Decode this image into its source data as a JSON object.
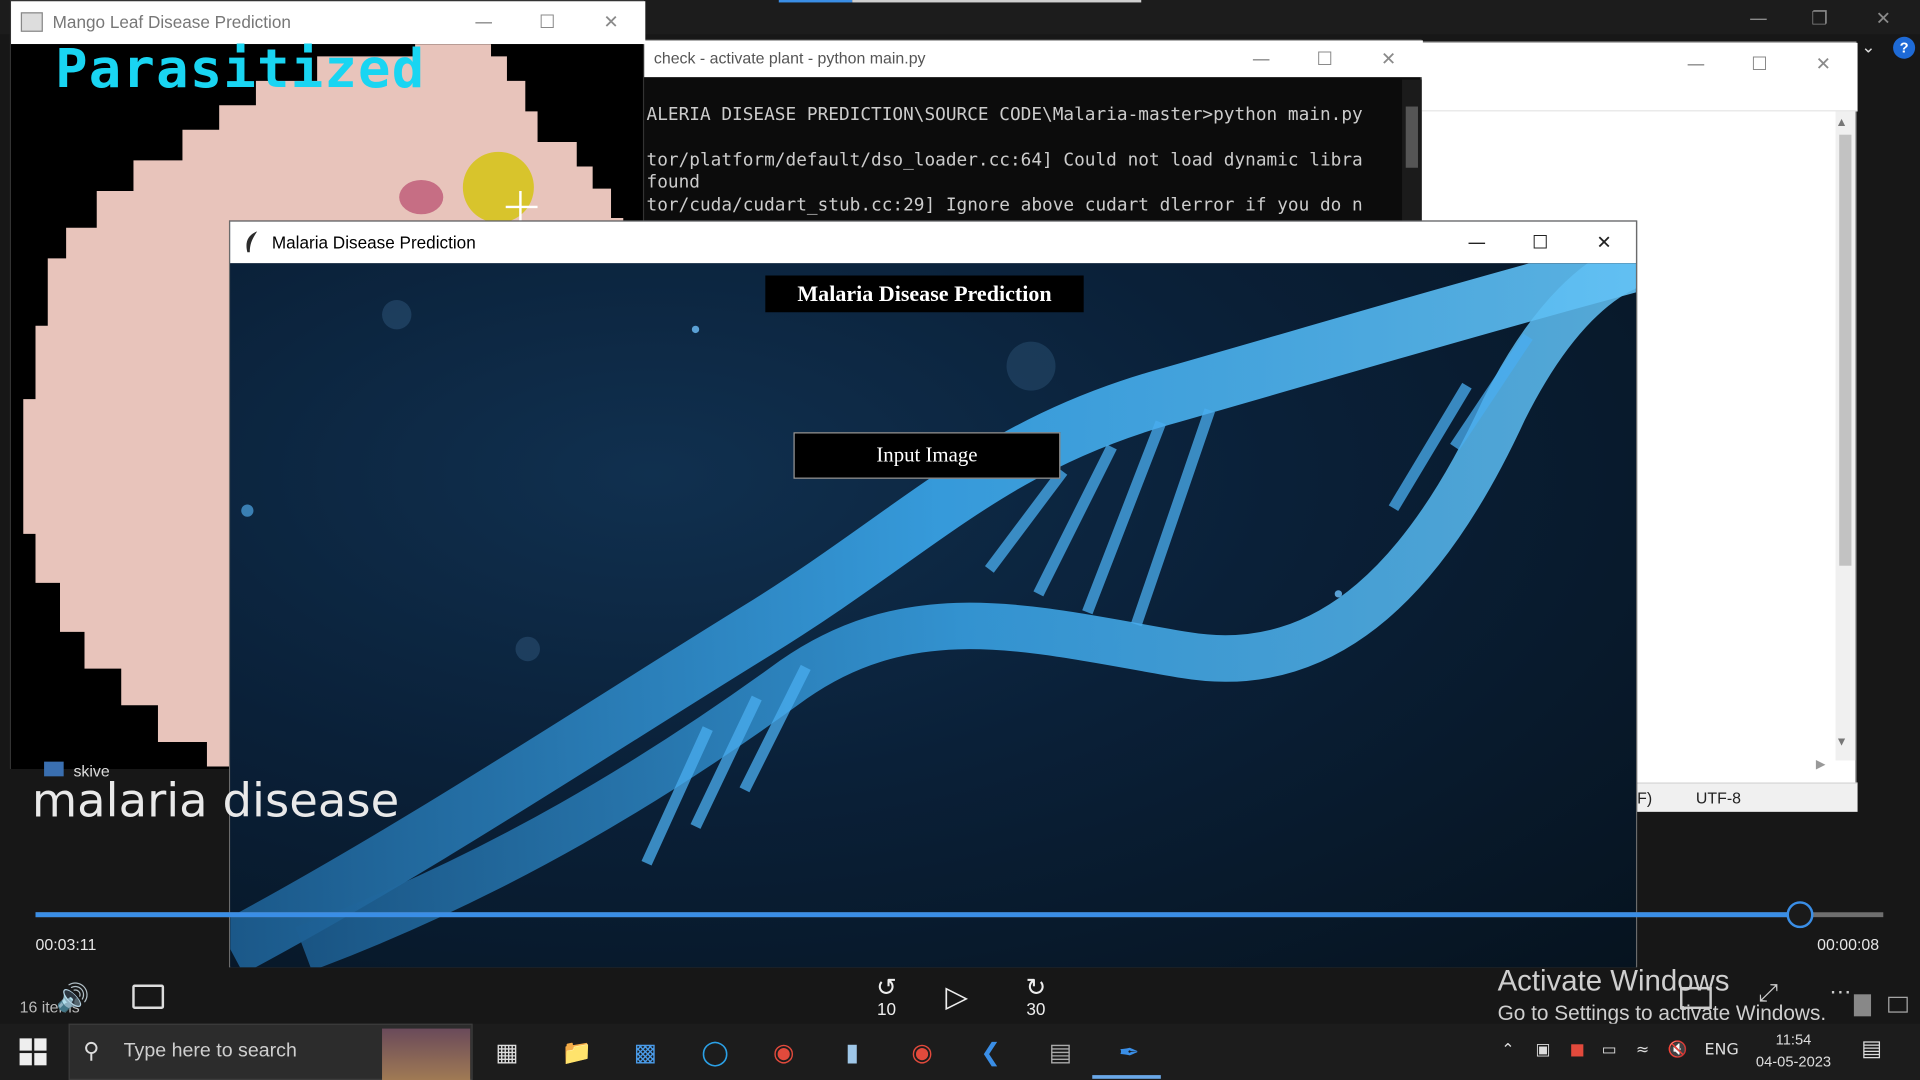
{
  "mango_window": {
    "title": "Mango Leaf Disease Prediction",
    "prediction_label": "Parasitized"
  },
  "console_window": {
    "title": "check - activate  plant - python  main.py",
    "lines": [
      "ALERIA DISEASE PREDICTION\\SOURCE CODE\\Malaria-master>python main.py",
      "tor/platform/default/dso_loader.cc:64] Could not load dynamic libra",
      "found",
      "tor/cuda/cudart_stub.cc:29] Ignore above cudart dlerror if you do n"
    ]
  },
  "editor_window": {
    "status_left": "F)",
    "encoding": "UTF-8"
  },
  "malaria_window": {
    "title": "Malaria Disease Prediction",
    "heading": "Malaria Disease Prediction",
    "input_button": "Input Image"
  },
  "player": {
    "folder_label": "skive",
    "video_title": "malaria disease",
    "elapsed": "00:03:11",
    "remaining": "00:00:08",
    "progress_fraction": 0.955,
    "skip_back": "10",
    "skip_forward": "30",
    "items_count": "16 items"
  },
  "activate_windows": {
    "line1": "Activate Windows",
    "line2": "Go to Settings to activate Windows."
  },
  "taskbar": {
    "search_placeholder": "Type here to search",
    "language": "ENG",
    "time": "11:54",
    "date": "04-05-2023"
  },
  "colors": {
    "accent": "#3a8ee6",
    "parasitized_text": "#19d5f2",
    "dna_blue": "#3aa6ea"
  }
}
